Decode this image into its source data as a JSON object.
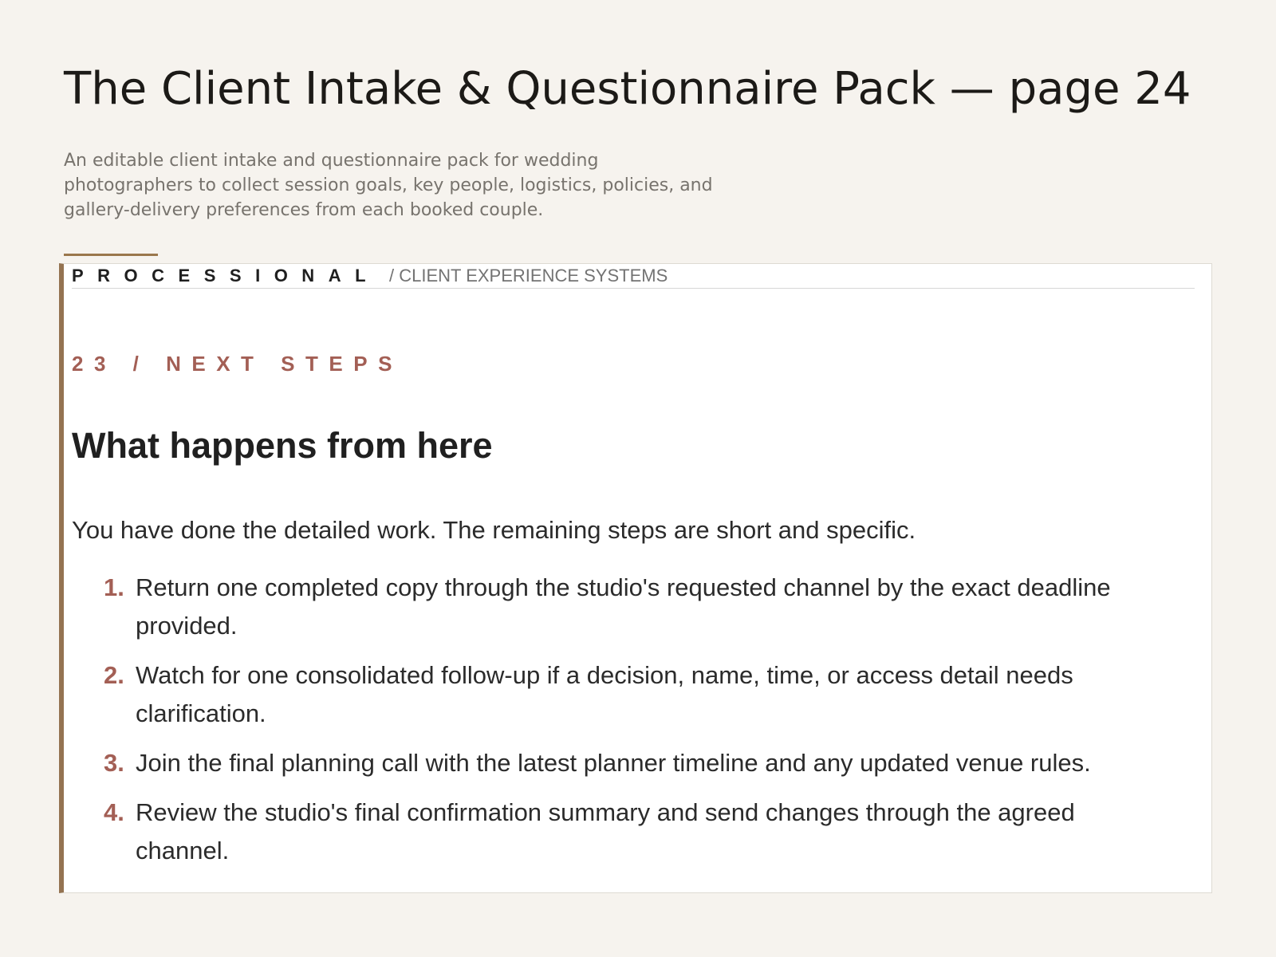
{
  "page": {
    "title": "The Client Intake & Questionnaire Pack — page 24",
    "subtitle": "An editable client intake and questionnaire pack for wedding photographers to collect session goals, key people, logistics, policies, and gallery-delivery preferences from each booked couple."
  },
  "document": {
    "brand": "PROCESSIONAL",
    "section_path": "/ CLIENT EXPERIENCE SYSTEMS",
    "eyebrow": "23 / NEXT STEPS",
    "heading": "What happens from here",
    "intro": "You have done the detailed work. The remaining steps are short and specific.",
    "steps": [
      {
        "number": "1.",
        "text": "Return one completed copy through the studio's requested channel by the exact deadline provided."
      },
      {
        "number": "2.",
        "text": "Watch for one consolidated follow-up if a decision, name, time, or access detail needs clarification."
      },
      {
        "number": "3.",
        "text": "Join the final planning call with the latest planner timeline and any updated venue rules."
      },
      {
        "number": "4.",
        "text": "Review the studio's final confirmation summary and send changes through the agreed channel."
      }
    ]
  },
  "colors": {
    "page_background": "#f6f3ee",
    "accent_bar": "#947351",
    "eyebrow_accent": "#a35f55",
    "title_text": "#1c1a17",
    "muted_text": "#77736d"
  }
}
